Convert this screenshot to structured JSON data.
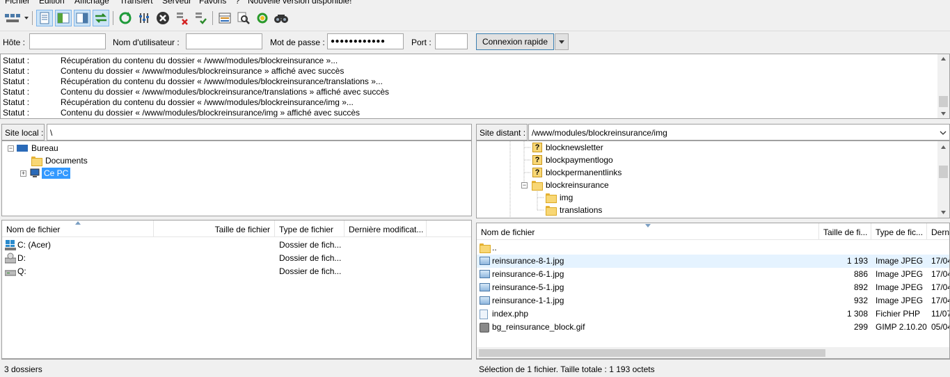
{
  "menu": [
    "Fichier",
    "Edition",
    "Affichage",
    "Transfert",
    "Serveur",
    "Favoris",
    "?",
    "Nouvelle version disponible!"
  ],
  "icons": {
    "site_manager": "site-manager-icon",
    "toggle_log": "message-log-icon",
    "toggle_local_tree": "local-tree-icon",
    "toggle_remote_tree": "remote-tree-icon",
    "toggle_queue": "transfer-queue-icon",
    "refresh": "refresh-icon",
    "process_queue": "process-queue-icon",
    "cancel": "cancel-icon",
    "disconnect": "disconnect-icon",
    "reconnect": "reconnect-icon",
    "filter": "filter-icon",
    "compare": "compare-icon",
    "sync": "sync-browse-icon",
    "search": "search-remote-icon"
  },
  "quickconnect": {
    "host_label": "Hôte :",
    "host_value": "",
    "user_label": "Nom d'utilisateur :",
    "user_value": "",
    "pass_label": "Mot de passe :",
    "pass_value": "●●●●●●●●●●●●",
    "port_label": "Port :",
    "port_value": "",
    "connect_label": "Connexion rapide"
  },
  "log": [
    {
      "key": "Statut :",
      "msg": "Récupération du contenu du dossier « /www/modules/blockreinsurance »..."
    },
    {
      "key": "Statut :",
      "msg": "Contenu du dossier « /www/modules/blockreinsurance » affiché avec succès"
    },
    {
      "key": "Statut :",
      "msg": "Récupération du contenu du dossier « /www/modules/blockreinsurance/translations »..."
    },
    {
      "key": "Statut :",
      "msg": "Contenu du dossier « /www/modules/blockreinsurance/translations » affiché avec succès"
    },
    {
      "key": "Statut :",
      "msg": "Récupération du contenu du dossier « /www/modules/blockreinsurance/img »..."
    },
    {
      "key": "Statut :",
      "msg": "Contenu du dossier « /www/modules/blockreinsurance/img » affiché avec succès"
    }
  ],
  "local": {
    "path_label": "Site local :",
    "path_value": "\\",
    "tree": [
      {
        "label": "Bureau",
        "expander": "−"
      },
      {
        "label": "Documents",
        "expander": ""
      },
      {
        "label": "Ce PC",
        "expander": "+"
      }
    ],
    "columns": [
      "Nom de fichier",
      "Taille de fichier",
      "Type de fichier",
      "Dernière modificat..."
    ],
    "rows": [
      {
        "name": "C: (Acer)",
        "size": "",
        "type": "Dossier de fich..."
      },
      {
        "name": "D:",
        "size": "",
        "type": "Dossier de fich..."
      },
      {
        "name": "Q:",
        "size": "",
        "type": "Dossier de fich..."
      }
    ],
    "status": "3 dossiers"
  },
  "remote": {
    "path_label": "Site distant :",
    "path_value": "/www/modules/blockreinsurance/img",
    "tree": [
      {
        "label": "blocknewsletter",
        "kind": "unknown"
      },
      {
        "label": "blockpaymentlogo",
        "kind": "unknown"
      },
      {
        "label": "blockpermanentlinks",
        "kind": "unknown"
      },
      {
        "label": "blockreinsurance",
        "kind": "folder",
        "expander": "−"
      },
      {
        "label": "img",
        "kind": "folder"
      },
      {
        "label": "translations",
        "kind": "folder"
      }
    ],
    "columns": [
      "Nom de fichier",
      "Taille de fi...",
      "Type de fic...",
      "Derni"
    ],
    "rows": [
      {
        "name": "..",
        "size": "",
        "type": "",
        "date": "",
        "icon": "folder"
      },
      {
        "name": "reinsurance-8-1.jpg",
        "size": "1 193",
        "type": "Image JPEG",
        "date": "17/04",
        "icon": "image"
      },
      {
        "name": "reinsurance-6-1.jpg",
        "size": "886",
        "type": "Image JPEG",
        "date": "17/04",
        "icon": "image"
      },
      {
        "name": "reinsurance-5-1.jpg",
        "size": "892",
        "type": "Image JPEG",
        "date": "17/04",
        "icon": "image"
      },
      {
        "name": "reinsurance-1-1.jpg",
        "size": "932",
        "type": "Image JPEG",
        "date": "17/04",
        "icon": "image"
      },
      {
        "name": "index.php",
        "size": "1 308",
        "type": "Fichier PHP",
        "date": "11/07",
        "icon": "php"
      },
      {
        "name": "bg_reinsurance_block.gif",
        "size": "299",
        "type": "GIMP 2.10.20",
        "date": "05/04",
        "icon": "gif"
      }
    ],
    "status": "Sélection de 1 fichier. Taille totale : 1 193 octets"
  }
}
